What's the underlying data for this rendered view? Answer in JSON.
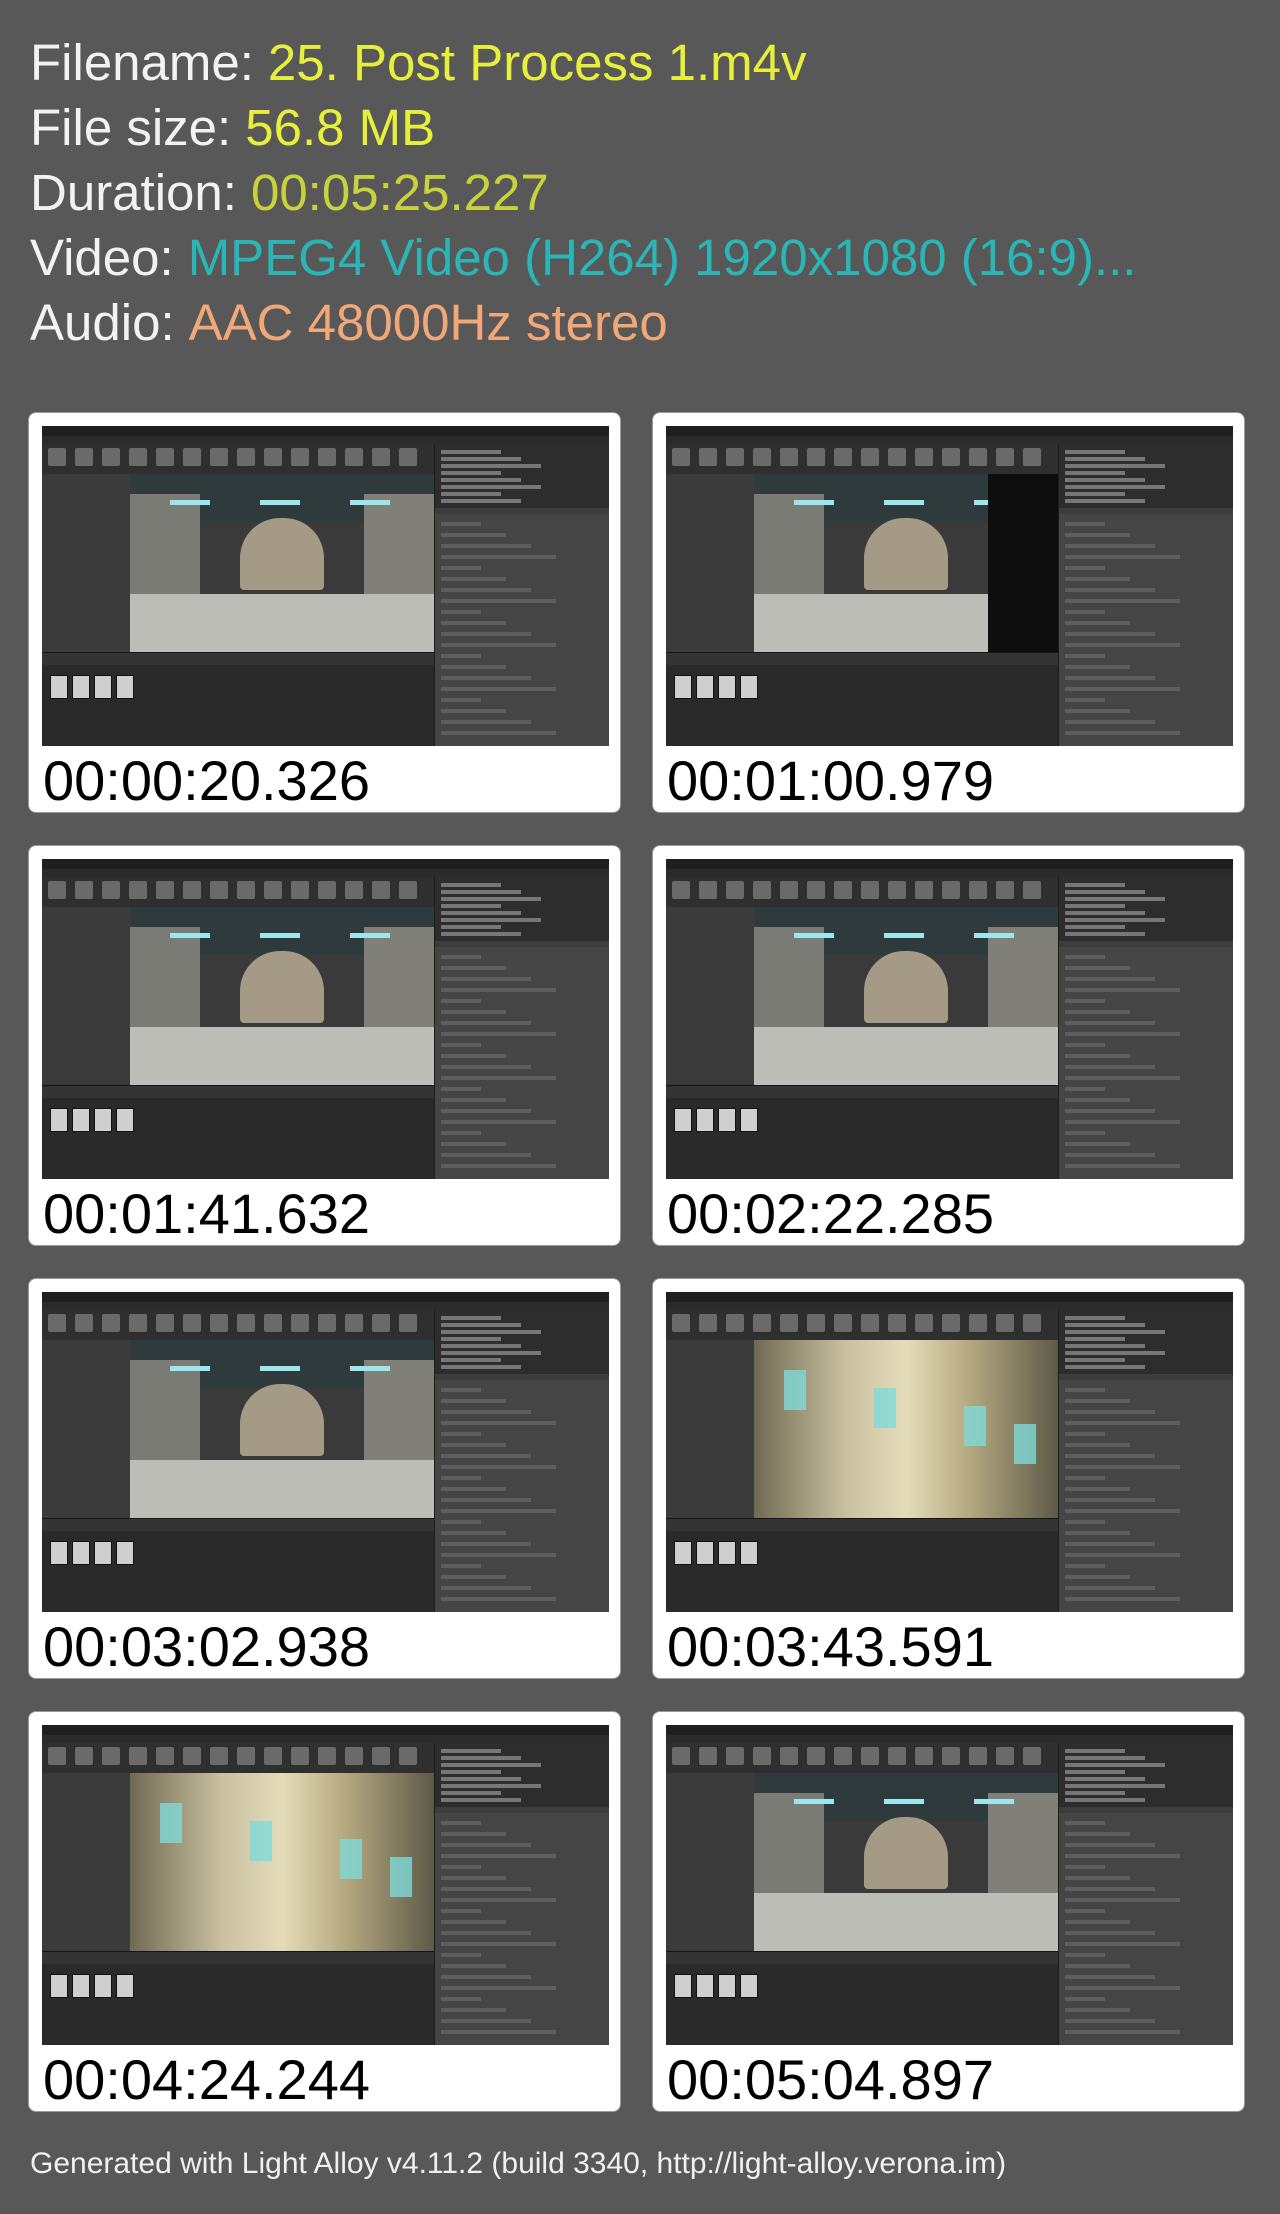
{
  "info": {
    "filename_label": "Filename:",
    "filename_value": "25. Post Process 1.m4v",
    "filesize_label": "File size:",
    "filesize_value": "56.8 MB",
    "duration_label": "Duration:",
    "duration_value": "00:05:25.227",
    "video_label": "Video:",
    "video_value": "MPEG4 Video (H264) 1920x1080 (16:9)...",
    "audio_label": "Audio:",
    "audio_value": "AAC 48000Hz stereo"
  },
  "colors": {
    "background": "#585858",
    "label": "#f2f2f2",
    "filename_value": "#e6f03c",
    "filesize_value": "#e6f03c",
    "duration_value": "#c8d23c",
    "video_value": "#2ab6b6",
    "audio_value": "#f0a878",
    "card": "#ffffff"
  },
  "thumbnails": [
    {
      "timestamp": "00:00:20.326",
      "style": "hall"
    },
    {
      "timestamp": "00:01:00.979",
      "style": "hall-dark"
    },
    {
      "timestamp": "00:01:41.632",
      "style": "hall"
    },
    {
      "timestamp": "00:02:22.285",
      "style": "hall"
    },
    {
      "timestamp": "00:03:02.938",
      "style": "hall"
    },
    {
      "timestamp": "00:03:43.591",
      "style": "blur"
    },
    {
      "timestamp": "00:04:24.244",
      "style": "blur"
    },
    {
      "timestamp": "00:05:04.897",
      "style": "hall"
    }
  ],
  "footer": {
    "text": "Generated with Light Alloy v4.11.2 (build 3340, http://light-alloy.verona.im)"
  }
}
